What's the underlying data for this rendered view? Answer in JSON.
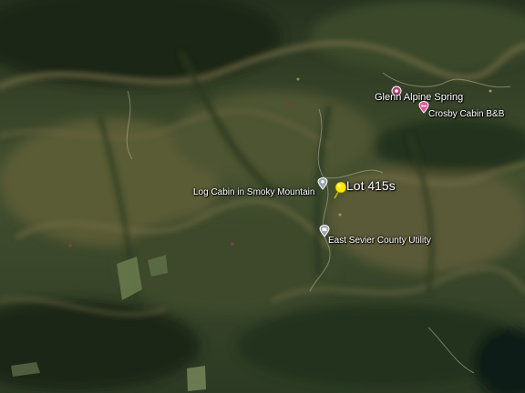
{
  "map": {
    "type": "satellite-3d-terrain",
    "scene": "forested mountain ridges and valleys",
    "places": [
      {
        "id": "glenn-alpine-spring",
        "label": "Glenn Alpine Spring",
        "icon": "spring-icon",
        "color": "#b0457a"
      },
      {
        "id": "crosby-cabin",
        "label": "Crosby Cabin B&B",
        "icon": "lodging-icon",
        "color": "#e2589b"
      },
      {
        "id": "log-cabin",
        "label": "Log Cabin in Smoky Mountain",
        "icon": "place-icon",
        "color": "#9aa4b0"
      },
      {
        "id": "lot-415s",
        "label": "Lot 415s",
        "icon": "pushpin-icon",
        "color": "#ffeb00"
      },
      {
        "id": "east-sevier",
        "label": "East Sevier County Utility",
        "icon": "utility-icon",
        "color": "#9aa4b0"
      }
    ]
  }
}
